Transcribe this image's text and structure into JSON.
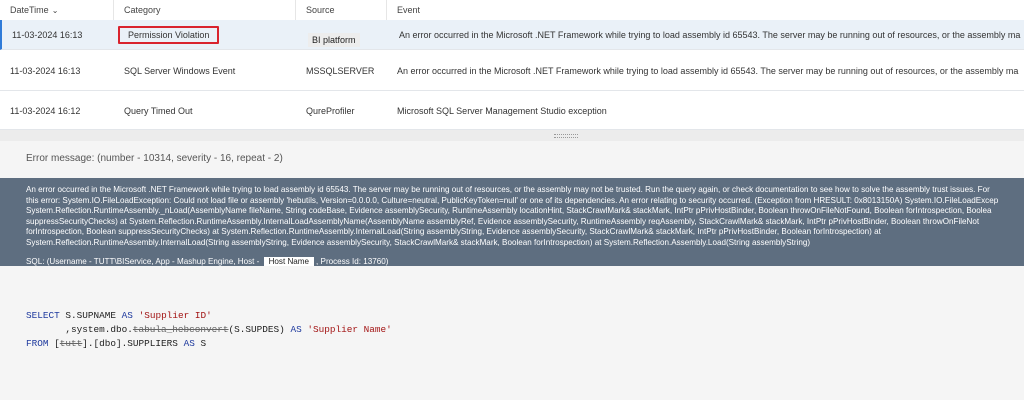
{
  "columns": {
    "datetime": "DateTime",
    "category": "Category",
    "source": "Source",
    "event": "Event"
  },
  "rows": [
    {
      "datetime": "11-03-2024 16:13",
      "category": "Permission Violation",
      "source": "BI platform",
      "event": "An error occurred in the Microsoft .NET Framework while trying to load assembly id 65543. The server may be running out of resources, or the assembly ma"
    },
    {
      "datetime": "11-03-2024 16:13",
      "category": "SQL Server Windows Event",
      "source": "MSSQLSERVER",
      "event": "An error occurred in the Microsoft .NET Framework while trying to load assembly id 65543. The server may be running out of resources, or the assembly ma"
    },
    {
      "datetime": "11-03-2024 16:12",
      "category": "Query Timed Out",
      "source": "QureProfiler",
      "event": "Microsoft SQL Server Management Studio exception"
    }
  ],
  "detail": {
    "error_message_label": "Error message: (number - 10314, severity - 16, repeat - 2)",
    "error_lines": [
      "An error occurred in the Microsoft .NET Framework while trying to load assembly id 65543. The server may be running out of resources, or the assembly may not be trusted. Run the query again, or check documentation to see how to solve the assembly trust issues. For",
      "this error: System.IO.FileLoadException: Could not load file or assembly 'hebutils, Version=0.0.0.0, Culture=neutral, PublicKeyToken=null' or one of its dependencies. An error relating to security occurred. (Exception from HRESULT: 0x8013150A) System.IO.FileLoadExcep",
      "System.Reflection.RuntimeAssembly._nLoad(AssemblyName fileName, String codeBase, Evidence assemblySecurity, RuntimeAssembly locationHint, StackCrawlMark& stackMark, IntPtr pPrivHostBinder, Boolean throwOnFileNotFound, Boolean forIntrospection, Boolea",
      "suppressSecurityChecks) at System.Reflection.RuntimeAssembly.InternalLoadAssemblyName(AssemblyName assemblyRef, Evidence assemblySecurity, RuntimeAssembly reqAssembly, StackCrawlMark& stackMark, IntPtr pPrivHostBinder, Boolean throwOnFileNot",
      "forIntrospection, Boolean suppressSecurityChecks) at System.Reflection.RuntimeAssembly.InternalLoad(String assemblyString, Evidence assemblySecurity, StackCrawlMark& stackMark, IntPtr pPrivHostBinder, Boolean forIntrospection) at",
      "System.Reflection.RuntimeAssembly.InternalLoad(String assemblyString, Evidence assemblySecurity, StackCrawlMark& stackMark, Boolean forIntrospection) at System.Reflection.Assembly.Load(String assemblyString)"
    ],
    "sql_prefix": "SQL: (Username - TUTT\\BIService, App - Mashup Engine, Host -",
    "host_name": "Host Name",
    "sql_suffix": ", Process Id: 13760)"
  },
  "code": {
    "select": "SELECT",
    "col1": " S.SUPNAME ",
    "as1": "AS",
    "alias1": "'Supplier ID'",
    "line2_prefix": "       ,system.dbo.",
    "line2_struck": "tabula_hebconvert",
    "line2_mid": "(S.SUPDES) ",
    "as2": "AS",
    "alias2": "'Supplier Name'",
    "from": "FROM",
    "from_open": " [",
    "from_struck": "tutt",
    "from_rest": "].[dbo].SUPPLIERS ",
    "as3": "AS",
    "from_alias": " S"
  }
}
